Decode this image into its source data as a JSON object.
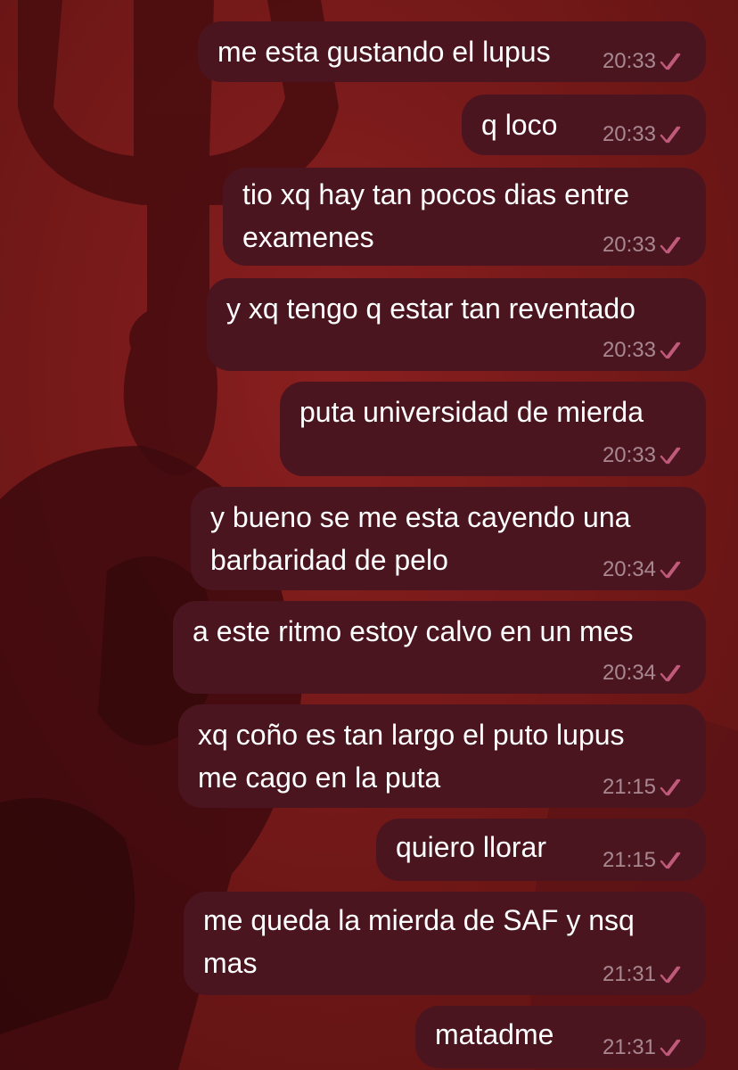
{
  "messages": [
    {
      "text": "me esta gustando el lupus",
      "time": "20:33",
      "status": "read"
    },
    {
      "text": "q loco",
      "time": "20:33",
      "status": "read"
    },
    {
      "text": "tio xq hay tan pocos dias entre\nexamenes",
      "time": "20:33",
      "status": "read"
    },
    {
      "text": "y xq tengo q estar tan reventado",
      "time": "20:33",
      "status": "read"
    },
    {
      "text": "puta universidad de mierda",
      "time": "20:33",
      "status": "read"
    },
    {
      "text": "y bueno se me esta cayendo una\nbarbaridad de pelo",
      "time": "20:34",
      "status": "read"
    },
    {
      "text": "a este ritmo estoy calvo en un mes",
      "time": "20:34",
      "status": "read"
    },
    {
      "text": "xq coño es tan largo el puto lupus\nme cago en la puta",
      "time": "21:15",
      "status": "read"
    },
    {
      "text": "quiero llorar",
      "time": "21:15",
      "status": "read"
    },
    {
      "text": "me queda la mierda de SAF y nsq\nmas",
      "time": "21:31",
      "status": "read"
    },
    {
      "text": "matadme",
      "time": "21:31",
      "status": "read"
    }
  ],
  "icons": {
    "status": "double-check-icon"
  },
  "colors": {
    "background": "#7a1a1a",
    "bubble": "#4b1520",
    "text": "#ffffff",
    "time": "#a88890",
    "check": "#c05a7a"
  }
}
